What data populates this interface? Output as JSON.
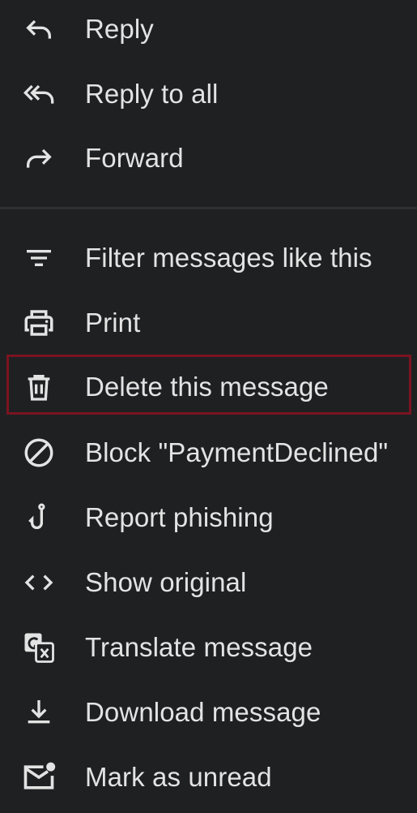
{
  "menu": {
    "items": [
      {
        "label": "Reply",
        "icon": "reply-icon"
      },
      {
        "label": "Reply to all",
        "icon": "reply-all-icon"
      },
      {
        "label": "Forward",
        "icon": "forward-icon"
      },
      {
        "label": "Filter messages like this",
        "icon": "filter-icon"
      },
      {
        "label": "Print",
        "icon": "print-icon"
      },
      {
        "label": "Delete this message",
        "icon": "trash-icon"
      },
      {
        "label": "Block \"PaymentDeclined\"",
        "icon": "block-icon"
      },
      {
        "label": "Report phishing",
        "icon": "hook-icon"
      },
      {
        "label": "Show original",
        "icon": "code-icon"
      },
      {
        "label": "Translate message",
        "icon": "translate-icon"
      },
      {
        "label": "Download message",
        "icon": "download-icon"
      },
      {
        "label": "Mark as unread",
        "icon": "mark-unread-icon"
      }
    ]
  },
  "colors": {
    "background": "#1f2022",
    "text": "#e3e3e3",
    "highlight_border": "#7a1420"
  }
}
